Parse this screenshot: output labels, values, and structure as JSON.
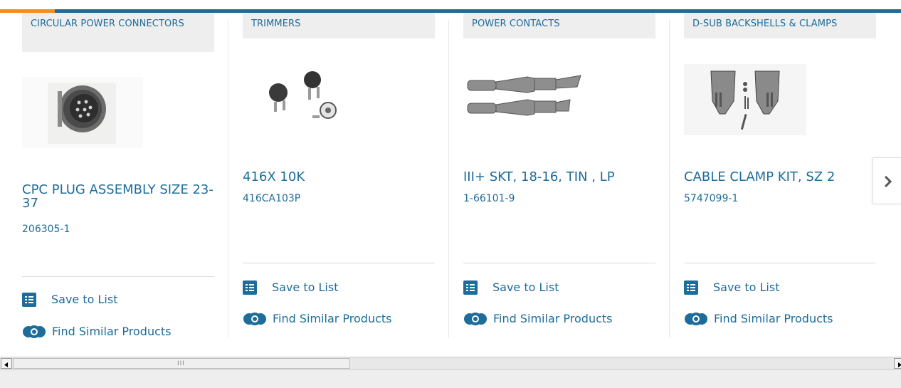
{
  "cards": [
    {
      "category": "CIRCULAR POWER CONNECTORS",
      "title": "CPC PLUG ASSEMBLY SIZE 23-37",
      "part": "206305-1",
      "save": "Save to List",
      "similar": "Find Similar Products"
    },
    {
      "category": "TRIMMERS",
      "title": "416X 10K",
      "part": "416CA103P",
      "save": "Save to List",
      "similar": "Find Similar Products"
    },
    {
      "category": "POWER CONTACTS",
      "title": "III+ SKT, 18-16, TIN , LP",
      "part": "1-66101-9",
      "save": "Save to List",
      "similar": "Find Similar Products"
    },
    {
      "category": "D-SUB BACKSHELLS & CLAMPS",
      "title": "CABLE CLAMP KIT, SZ 2",
      "part": "5747099-1",
      "save": "Save to List",
      "similar": "Find Similar Products"
    }
  ],
  "scrollbar": {
    "grip": "III"
  },
  "colors": {
    "link": "#1d6c99",
    "accent": "#f28d1f",
    "header": "#eeeeee"
  },
  "icons": {
    "save": "checklist-icon",
    "similar": "similar-products-icon",
    "next": "chevron-right-icon",
    "scroll_left": "triangle-left-icon",
    "scroll_right": "triangle-right-icon"
  }
}
